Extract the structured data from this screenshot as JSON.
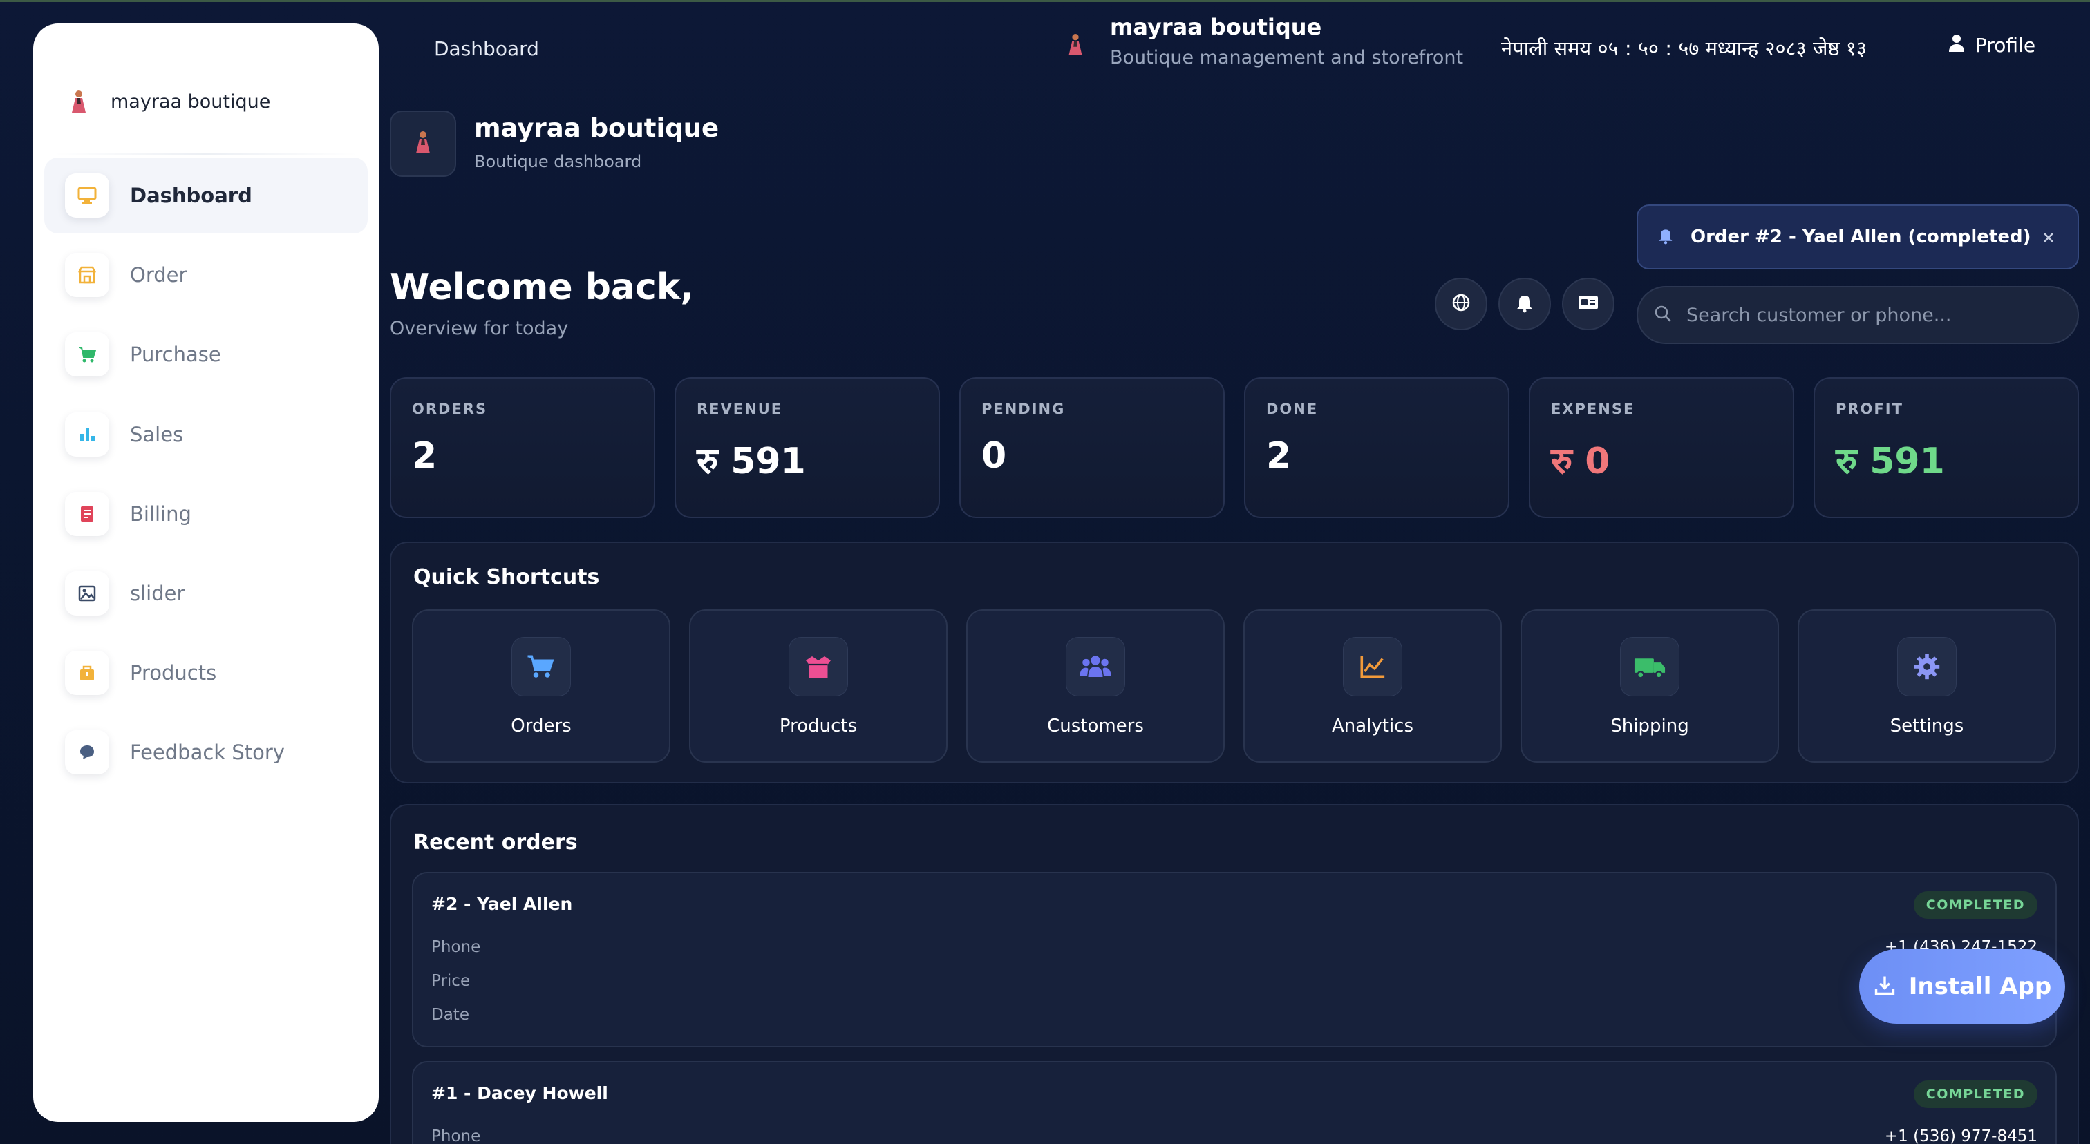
{
  "sidebar": {
    "brand": "mayraa boutique",
    "items": [
      {
        "label": "Dashboard",
        "icon": "monitor-icon",
        "color": "#f2b23a",
        "active": true
      },
      {
        "label": "Order",
        "icon": "store-icon",
        "color": "#f2b23a"
      },
      {
        "label": "Purchase",
        "icon": "cart-icon",
        "color": "#2fb86a"
      },
      {
        "label": "Sales",
        "icon": "bar-chart-icon",
        "color": "#35b6e8"
      },
      {
        "label": "Billing",
        "icon": "receipt-icon",
        "color": "#e0445a"
      },
      {
        "label": "slider",
        "icon": "image-icon",
        "color": "#3a4a66"
      },
      {
        "label": "Products",
        "icon": "package-icon",
        "color": "#f2b23a"
      },
      {
        "label": "Feedback Story",
        "icon": "chat-icon",
        "color": "#4a5f82"
      }
    ]
  },
  "header": {
    "page": "Dashboard",
    "title": "mayraa boutique",
    "subtitle": "Boutique management and storefront",
    "time": "नेपाली समय ०५ : ५० : ५७ मध्यान्ह   २०८३ जेष्ठ १३",
    "profile": "Profile"
  },
  "shop": {
    "name": "mayraa boutique",
    "subtitle": "Boutique dashboard"
  },
  "welcome": {
    "title": "Welcome back,",
    "subtitle": "Overview for today"
  },
  "notification": {
    "text": "Order #2 - Yael Allen (completed)"
  },
  "search": {
    "placeholder": "Search customer or phone..."
  },
  "stats": [
    {
      "label": "ORDERS",
      "value": "2"
    },
    {
      "label": "REVENUE",
      "value": "रु 591"
    },
    {
      "label": "PENDING",
      "value": "0"
    },
    {
      "label": "DONE",
      "value": "2"
    },
    {
      "label": "EXPENSE",
      "value": "रु 0",
      "color": "#f0777a"
    },
    {
      "label": "PROFIT",
      "value": "रु 591",
      "color": "#6fd98a"
    }
  ],
  "shortcuts": {
    "title": "Quick Shortcuts",
    "items": [
      {
        "label": "Orders",
        "icon": "cart-icon",
        "color": "#5aa7ff"
      },
      {
        "label": "Products",
        "icon": "box-icon",
        "color": "#ec4f93"
      },
      {
        "label": "Customers",
        "icon": "users-icon",
        "color": "#6b74f0"
      },
      {
        "label": "Analytics",
        "icon": "line-chart-icon",
        "color": "#f29a3a"
      },
      {
        "label": "Shipping",
        "icon": "truck-icon",
        "color": "#3bbd6a"
      },
      {
        "label": "Settings",
        "icon": "gear-icon",
        "color": "#8b96f5"
      }
    ]
  },
  "recent": {
    "title": "Recent orders",
    "orders": [
      {
        "title": "#2 - Yael Allen",
        "status": "COMPLETED",
        "phone_label": "Phone",
        "phone": "+1 (436) 247-1522",
        "price_label": "Price",
        "date_label": "Date"
      },
      {
        "title": "#1 - Dacey Howell",
        "status": "COMPLETED",
        "phone_label": "Phone",
        "phone": "+1 (536) 977-8451"
      }
    ]
  },
  "install": {
    "label": "Install App"
  }
}
